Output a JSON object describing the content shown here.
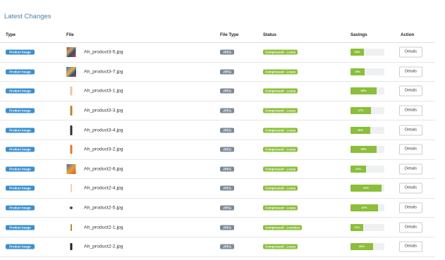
{
  "page": {
    "title": "Latest Changes"
  },
  "table": {
    "headers": {
      "type": "Type",
      "file": "File",
      "file_type": "File Type",
      "status": "Status",
      "savings": "Savings",
      "action": "Action"
    },
    "rows": [
      {
        "type": "Product Image",
        "thumb": "product-thumbnail-multicolor-collage",
        "file": "Ah_product3-5.jpg",
        "file_type": "JPEG",
        "status": "Compressed - Lossy",
        "savings_percent": 18,
        "savings_label": "18%",
        "action": "Details"
      },
      {
        "type": "Product Image",
        "thumb": "product-thumbnail-blue-collage",
        "file": "Ah_product3-7.jpg",
        "file_type": "JPEG",
        "status": "Compressed - Lossy",
        "savings_percent": 19,
        "savings_label": "19%",
        "action": "Details"
      },
      {
        "type": "Product Image",
        "thumb": "product-thumbnail-peach-bottle",
        "file": "Ah_product3-1.jpg",
        "file_type": "JPEG",
        "status": "Compressed - Lossy",
        "savings_percent": 35,
        "savings_label": "35%",
        "action": "Details"
      },
      {
        "type": "Product Image",
        "thumb": "product-thumbnail-gold-bottle",
        "file": "Ah_product3-3.jpg",
        "file_type": "JPEG",
        "status": "Compressed - Lossy",
        "savings_percent": 27,
        "savings_label": "27%",
        "action": "Details"
      },
      {
        "type": "Product Image",
        "thumb": "product-thumbnail-dark-bottle",
        "file": "Ah_product3-4.jpg",
        "file_type": "JPEG",
        "status": "Compressed - Lossy",
        "savings_percent": 26,
        "savings_label": "26%",
        "action": "Details"
      },
      {
        "type": "Product Image",
        "thumb": "product-thumbnail-orange-bottle",
        "file": "Ah_product3-2.jpg",
        "file_type": "JPEG",
        "status": "Compressed - Lossy",
        "savings_percent": 35,
        "savings_label": "35%",
        "action": "Details"
      },
      {
        "type": "Product Image",
        "thumb": "product-thumbnail-blue-orange-collage",
        "file": "Ah_product2-6.jpg",
        "file_type": "JPEG",
        "status": "Compressed - Lossy",
        "savings_percent": 21,
        "savings_label": "21%",
        "action": "Details"
      },
      {
        "type": "Product Image",
        "thumb": "product-thumbnail-light-tube",
        "file": "Ah_product2-4.jpg",
        "file_type": "JPEG",
        "status": "Compressed - Lossy",
        "savings_percent": 41,
        "savings_label": "41%",
        "action": "Details"
      },
      {
        "type": "Product Image",
        "thumb": "product-thumbnail-small-brush",
        "file": "Ah_product2-5.jpg",
        "file_type": "JPEG",
        "status": "Compressed - Lossy",
        "savings_percent": 37,
        "savings_label": "37%",
        "action": "Details"
      },
      {
        "type": "Product Image",
        "thumb": "product-thumbnail-gold-vial",
        "file": "Ah_product2-1.jpg",
        "file_type": "JPEG",
        "status": "Compressed - Lossless",
        "savings_percent": 17,
        "savings_label": "17%",
        "action": "Details"
      },
      {
        "type": "Product Image",
        "thumb": "product-thumbnail-black-vial",
        "file": "Ah_product2-2.jpg",
        "file_type": "JPEG",
        "status": "Compressed - Lossy",
        "savings_percent": 30,
        "savings_label": "30%",
        "action": "Details"
      }
    ]
  },
  "colors": {
    "title": "#4a7fa8",
    "type_label": "#3a8fd0",
    "file_type_label": "#7c8a99",
    "status_label": "#8bbe3a",
    "savings_bar": "#8bbe3a"
  }
}
